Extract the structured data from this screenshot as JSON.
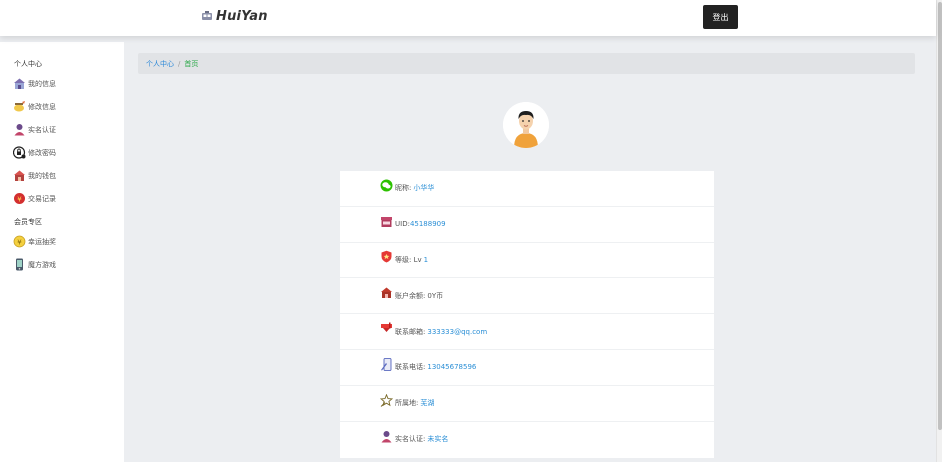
{
  "header": {
    "logo_text": "HuiYan",
    "logout_label": "登出"
  },
  "sidebar": {
    "section_personal": "个人中心",
    "personal_items": [
      {
        "label": "我的信息",
        "icon": "house-icon"
      },
      {
        "label": "修改信息",
        "icon": "edit-pot-icon"
      },
      {
        "label": "实名认证",
        "icon": "person-icon"
      },
      {
        "label": "修改密码",
        "icon": "lock-icon"
      },
      {
        "label": "我的钱包",
        "icon": "wallet-house-icon"
      },
      {
        "label": "交易记录",
        "icon": "yen-badge-icon"
      }
    ],
    "section_member": "会员专区",
    "member_items": [
      {
        "label": "幸运抽奖",
        "icon": "lucky-coin-icon"
      },
      {
        "label": "魔方游戏",
        "icon": "phone-icon"
      }
    ]
  },
  "breadcrumb": {
    "parent": "个人中心",
    "separator": "/",
    "current": "首页"
  },
  "profile": {
    "rows": [
      {
        "label": "昵称:",
        "value": "小华华",
        "icon": "wechat-icon"
      },
      {
        "label": "UID:",
        "value": "45188909",
        "icon": "shop-icon"
      },
      {
        "label": "等级: Lv",
        "value": "1",
        "icon": "shield-icon"
      },
      {
        "label": "账户余额:",
        "value": "0Y币",
        "icon": "house-coin-icon"
      },
      {
        "label": "联系邮箱:",
        "value": "333333@qq.com",
        "icon": "mail-icon"
      },
      {
        "label": "联系电话:",
        "value": "13045678596",
        "icon": "phone-pen-icon"
      },
      {
        "label": "所属地:",
        "value": "芜湖",
        "icon": "location-star-icon"
      },
      {
        "label": "实名认证:",
        "value": "未实名",
        "icon": "person-icon"
      }
    ]
  },
  "colors": {
    "link_blue": "#2b88d8",
    "breadcrumb_current_green": "#28a745",
    "logout_bg": "#222222",
    "page_bg": "#eceef1"
  }
}
